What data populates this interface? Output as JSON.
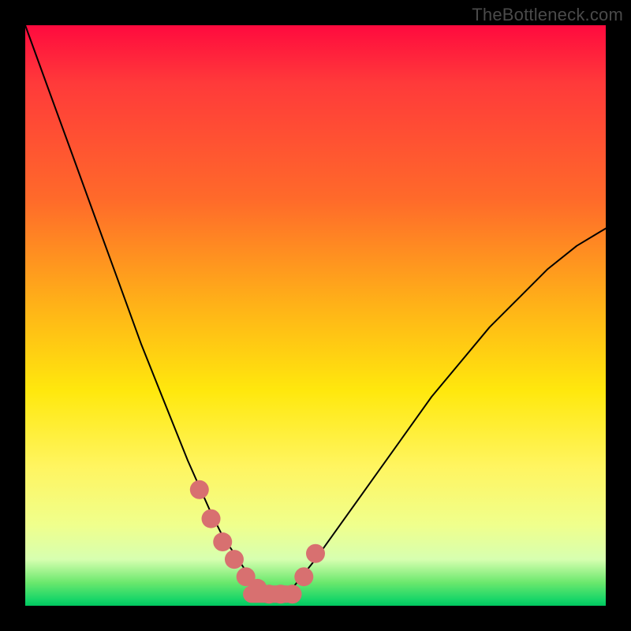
{
  "watermark": "TheBottleneck.com",
  "colors": {
    "background": "#000000",
    "gradient_top": "#ff0a3e",
    "gradient_mid": "#ffe80d",
    "gradient_bottom": "#00c75f",
    "curve": "#000000",
    "marker": "#d87070"
  },
  "chart_data": {
    "type": "line",
    "title": "",
    "xlabel": "",
    "ylabel": "",
    "xlim": [
      0,
      100
    ],
    "ylim": [
      0,
      100
    ],
    "series": [
      {
        "name": "bottleneck-curve",
        "x": [
          0,
          4,
          8,
          12,
          16,
          20,
          24,
          28,
          32,
          34,
          36,
          38,
          40,
          42,
          44,
          46,
          50,
          55,
          60,
          65,
          70,
          75,
          80,
          85,
          90,
          95,
          100
        ],
        "values": [
          100,
          89,
          78,
          67,
          56,
          45,
          35,
          25,
          16,
          12,
          9,
          6,
          3,
          2,
          2,
          3,
          8,
          15,
          22,
          29,
          36,
          42,
          48,
          53,
          58,
          62,
          65
        ]
      }
    ],
    "markers": {
      "name": "highlight-dots",
      "x": [
        30,
        32,
        34,
        36,
        38,
        40,
        42,
        44,
        46,
        48,
        50
      ],
      "values": [
        20,
        15,
        11,
        8,
        5,
        3,
        2,
        2,
        2,
        5,
        9
      ]
    },
    "flat_segment": {
      "x0": 39,
      "x1": 45,
      "y": 2
    },
    "annotations": [],
    "legend": []
  }
}
